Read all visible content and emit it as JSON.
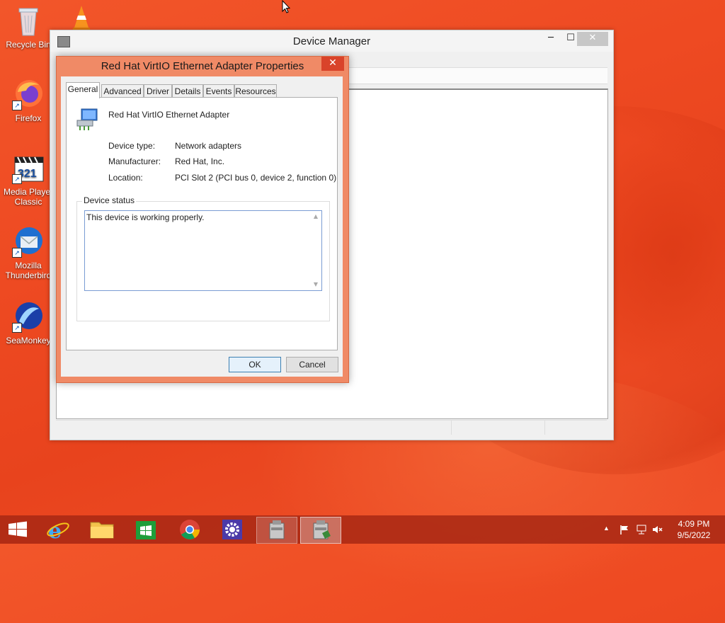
{
  "desktop": {
    "icons": [
      {
        "label": "Recycle Bin"
      },
      {
        "label": "Firefox"
      },
      {
        "label": "Media Player Classic"
      },
      {
        "label": "Mozilla Thunderbird"
      },
      {
        "label": "SeaMonkey"
      }
    ]
  },
  "device_manager": {
    "title": "Device Manager",
    "controls": {
      "minimize": "─",
      "maximize": "☐",
      "close": "✕"
    }
  },
  "properties": {
    "title": "Red Hat VirtIO Ethernet Adapter Properties",
    "close": "✕",
    "tabs": [
      "General",
      "Advanced",
      "Driver",
      "Details",
      "Events",
      "Resources"
    ],
    "active_tab": "General",
    "device_name": "Red Hat VirtIO Ethernet Adapter",
    "fields": {
      "device_type_label": "Device type:",
      "device_type_value": "Network adapters",
      "manufacturer_label": "Manufacturer:",
      "manufacturer_value": "Red Hat, Inc.",
      "location_label": "Location:",
      "location_value": "PCI Slot 2 (PCI bus 0, device 2, function 0)"
    },
    "status_group_label": "Device status",
    "status_text": "This device is working properly.",
    "ok_label": "OK",
    "cancel_label": "Cancel"
  },
  "taskbar": {
    "items": [
      "start",
      "internet-explorer",
      "file-explorer",
      "store",
      "chrome",
      "settings",
      "device-manager",
      "device-manager-properties"
    ],
    "clock_time": "4:09 PM",
    "clock_date": "9/5/2022"
  }
}
